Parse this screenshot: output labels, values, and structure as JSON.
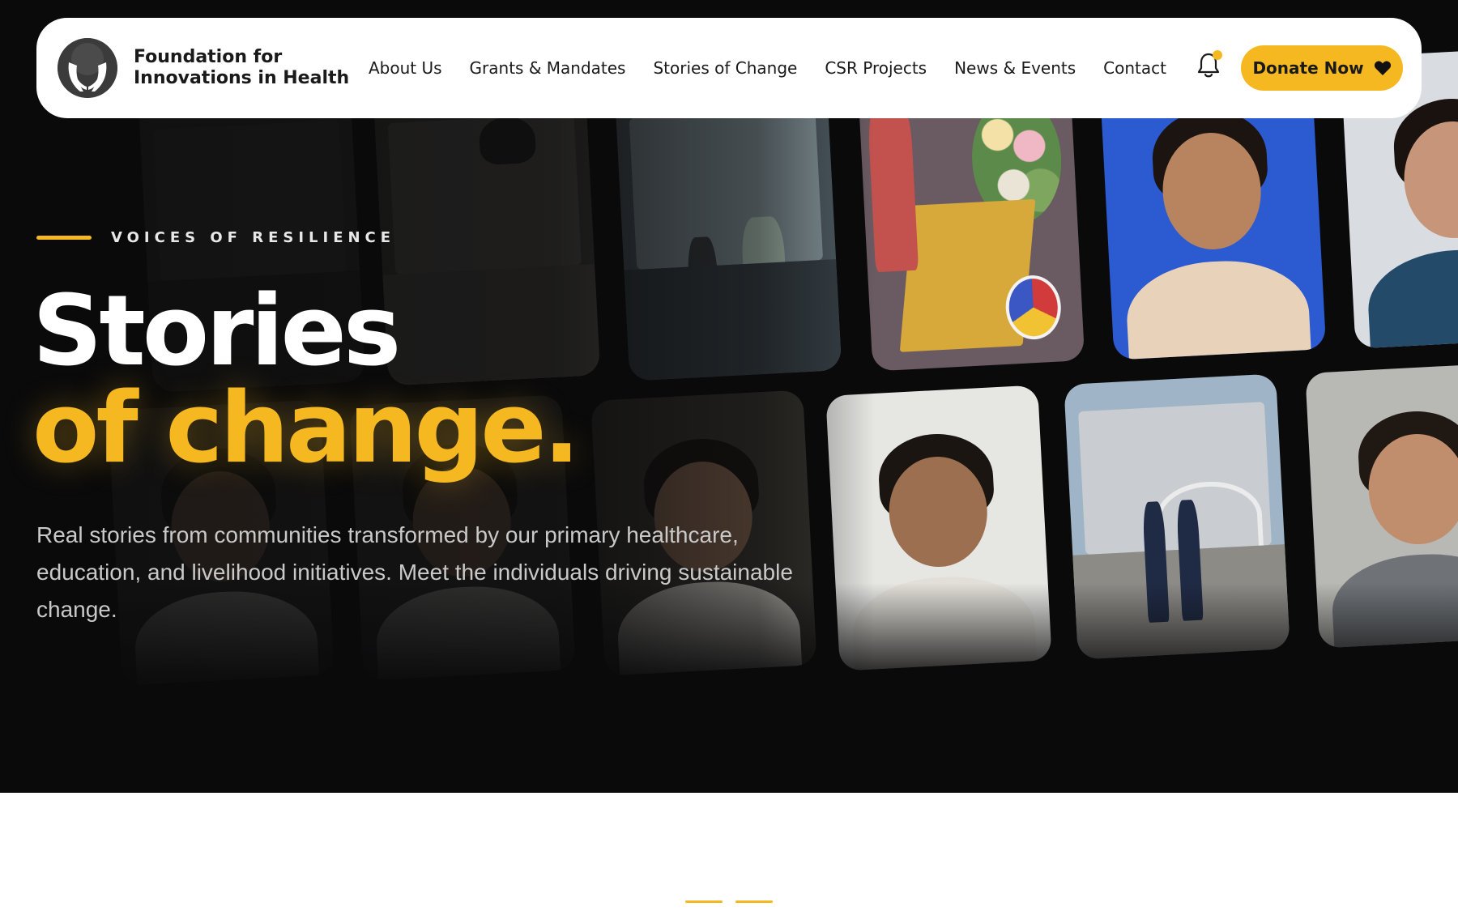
{
  "brand": {
    "name_line1": "Foundation for",
    "name_line2": "Innovations in Health",
    "logo_icon": "hands-holding-globe-icon"
  },
  "nav": {
    "items": [
      {
        "label": "About Us"
      },
      {
        "label": "Grants & Mandates"
      },
      {
        "label": "Stories of Change"
      },
      {
        "label": "CSR Projects"
      },
      {
        "label": "News & Events"
      },
      {
        "label": "Contact"
      }
    ],
    "notification_icon": "bell-icon",
    "donate_label": "Donate Now",
    "donate_icon": "heart-icon"
  },
  "hero": {
    "eyebrow": "VOICES OF RESILIENCE",
    "title_line1": "Stories",
    "title_line2": "of change.",
    "description": "Real stories from communities transformed by our primary healthcare, education, and livelihood initiatives. Meet the individuals driving sustainable change."
  },
  "colors": {
    "accent": "#f5b820",
    "hero_background": "#0a0a0b",
    "navbar_background": "#ffffff",
    "text_dark": "#1a1a1a"
  }
}
